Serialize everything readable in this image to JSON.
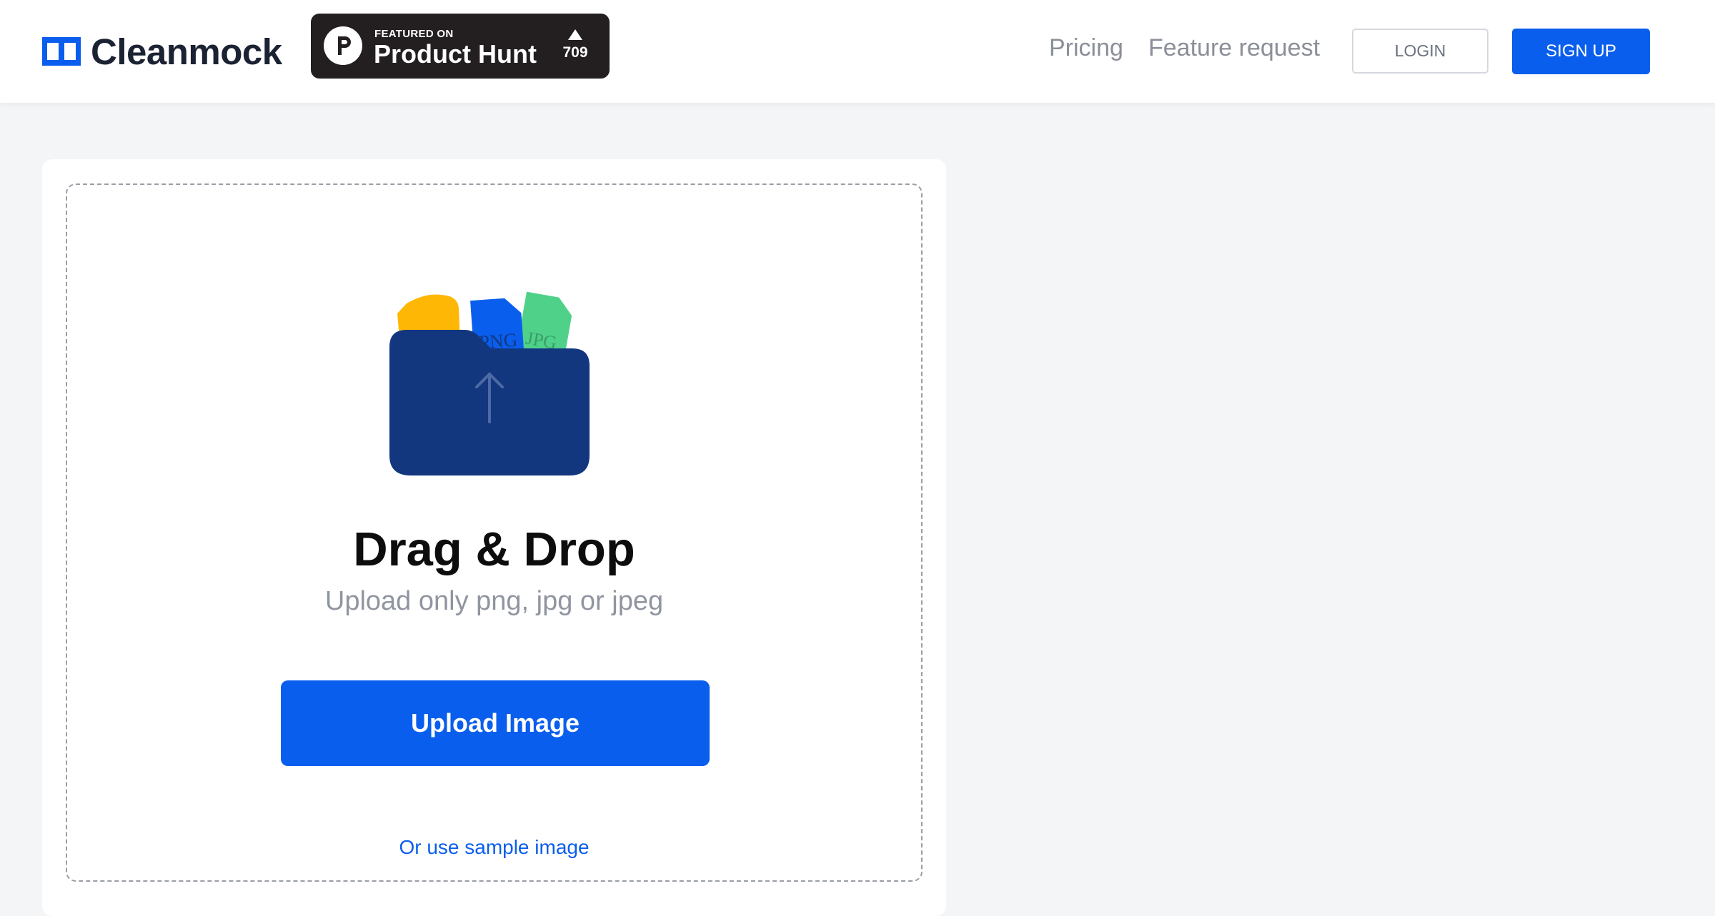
{
  "header": {
    "logo": {
      "text": "Cleanmock",
      "icon": "cleanmock-logo-icon"
    },
    "product_hunt": {
      "featured_label": "FEATURED ON",
      "name": "Product Hunt",
      "votes": "709",
      "icon": "product-hunt-icon",
      "arrow_icon": "upvote-triangle-icon"
    },
    "nav": {
      "pricing": "Pricing",
      "feature_request": "Feature request"
    },
    "login_label": "LOGIN",
    "signup_label": "SIGN UP"
  },
  "upload": {
    "illustration_icon": "folder-upload-icon",
    "file_labels": [
      "PNG",
      "JPG"
    ],
    "title": "Drag & Drop",
    "subtitle": "Upload only png, jpg or jpeg",
    "button_label": "Upload Image",
    "sample_link": "Or use sample image"
  },
  "colors": {
    "brand_blue": "#0a5eed",
    "folder_navy": "#12377f",
    "file_yellow": "#ffb705",
    "file_green": "#4fd18a",
    "background": "#f4f5f7",
    "product_hunt_badge": "#231f20"
  }
}
